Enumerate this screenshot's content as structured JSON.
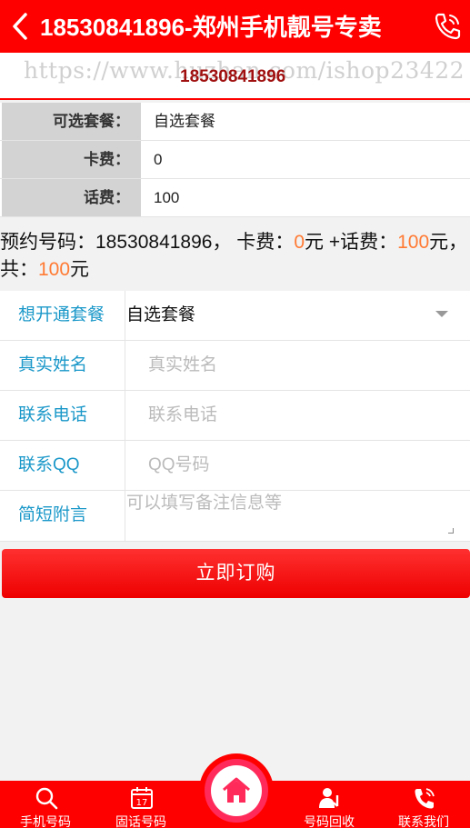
{
  "header": {
    "title": "18530841896-郑州手机靓号专卖"
  },
  "banner": {
    "watermark": "https://www.huzhan.com/ishop23422",
    "number": "18530841896"
  },
  "info": [
    {
      "key": "可选套餐：",
      "value": "自选套餐"
    },
    {
      "key": "卡费：",
      "value": "0"
    },
    {
      "key": "话费：",
      "value": "100"
    }
  ],
  "summary": {
    "prefix": "预约号码：18530841896， 卡费：",
    "card_fee": "0",
    "mid": "元 +话费：",
    "phone_fee": "100",
    "mid2": "元，共：",
    "total": "100",
    "suffix": "元"
  },
  "form": {
    "plan_label": "想开通套餐",
    "plan_value": "自选套餐",
    "name_label": "真实姓名",
    "name_placeholder": "真实姓名",
    "phone_label": "联系电话",
    "phone_placeholder": "联系电话",
    "qq_label": "联系QQ",
    "qq_placeholder": "QQ号码",
    "note_label": "简短附言",
    "note_placeholder": "可以填写备注信息等"
  },
  "submit_label": "立即订购",
  "bottom_nav": [
    {
      "label": "手机号码",
      "icon": "search-icon"
    },
    {
      "label": "固话号码",
      "icon": "calendar-icon"
    },
    {
      "label": "首页",
      "icon": "home-icon"
    },
    {
      "label": "号码回收",
      "icon": "user-recycle-icon"
    },
    {
      "label": "联系我们",
      "icon": "phone-call-icon"
    }
  ],
  "colors": {
    "brand_red": "#ff0000",
    "highlight_orange": "#ff7a33",
    "label_blue": "#1b98c9"
  }
}
